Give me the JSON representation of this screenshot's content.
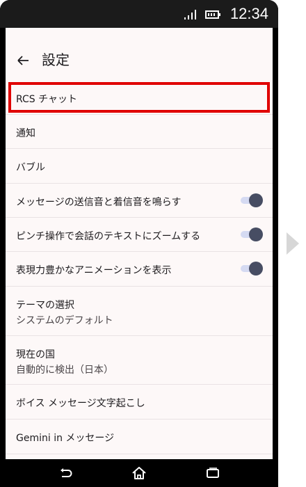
{
  "status_bar": {
    "time": "12:34",
    "signal_icon": "signal-icon",
    "battery_icon": "battery-icon"
  },
  "app_bar": {
    "back_icon": "arrow-back-icon",
    "title": "設定"
  },
  "settings": {
    "items": [
      {
        "label": "RCS チャット"
      },
      {
        "label": "通知"
      },
      {
        "label": "バブル"
      },
      {
        "label": "メッセージの送信音と着信音を鳴らす",
        "toggle_on": true
      },
      {
        "label": "ピンチ操作で会話のテキストにズームする",
        "toggle_on": true
      },
      {
        "label": "表現力豊かなアニメーションを表示",
        "toggle_on": true
      },
      {
        "label": "テーマの選択",
        "sub": "システムのデフォルト"
      },
      {
        "label": "現在の国",
        "sub": "自動的に検出（日本）"
      },
      {
        "label": "ボイス メッセージ文字起こし"
      },
      {
        "label": "Gemini in メッセージ"
      }
    ]
  },
  "nav_bar": {
    "back_icon": "nav-back-icon",
    "home_icon": "home-icon",
    "recents_icon": "recents-icon"
  },
  "colors": {
    "highlight": "#e00000",
    "toggle_thumb": "#474d63",
    "toggle_track": "#d5daf2",
    "background": "#fdf8f8"
  }
}
